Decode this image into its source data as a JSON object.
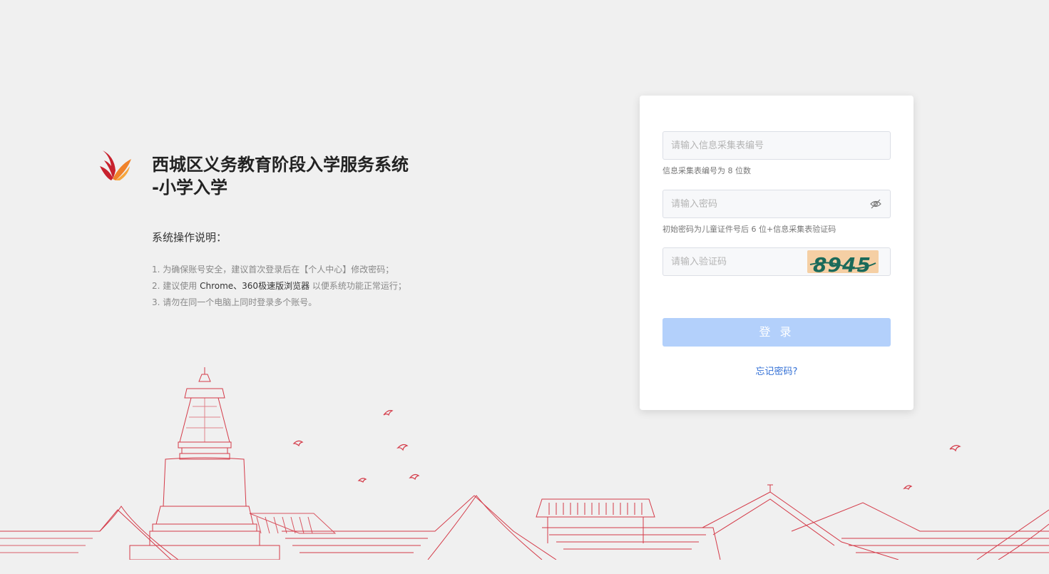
{
  "branding": {
    "title_line1": "西城区义务教育阶段入学服务系统",
    "title_line2": "-小学入学",
    "logo_icon": "phoenix-flame-icon"
  },
  "instructions": {
    "heading": "系统操作说明：",
    "item1": "1. 为确保账号安全，建议首次登录后在【个人中心】修改密码；",
    "item2_prefix": "2. 建议使用 ",
    "item2_highlight": "Chrome、360极速版浏览器",
    "item2_suffix": " 以便系统功能正常运行；",
    "item3": "3. 请勿在同一个电脑上同时登录多个账号。"
  },
  "login": {
    "form_id_placeholder": "请输入信息采集表编号",
    "form_id_hint": "信息采集表编号为 8 位数",
    "password_placeholder": "请输入密码",
    "password_hint": "初始密码为儿童证件号后 6 位+信息采集表验证码",
    "captcha_placeholder": "请输入验证码",
    "captcha_text": "8945",
    "submit_label": "登 录",
    "forgot_label": "忘记密码?"
  },
  "colors": {
    "accent": "#3370d6",
    "button_disabled": "#b3d0fb",
    "line_art": "#d43a48"
  }
}
